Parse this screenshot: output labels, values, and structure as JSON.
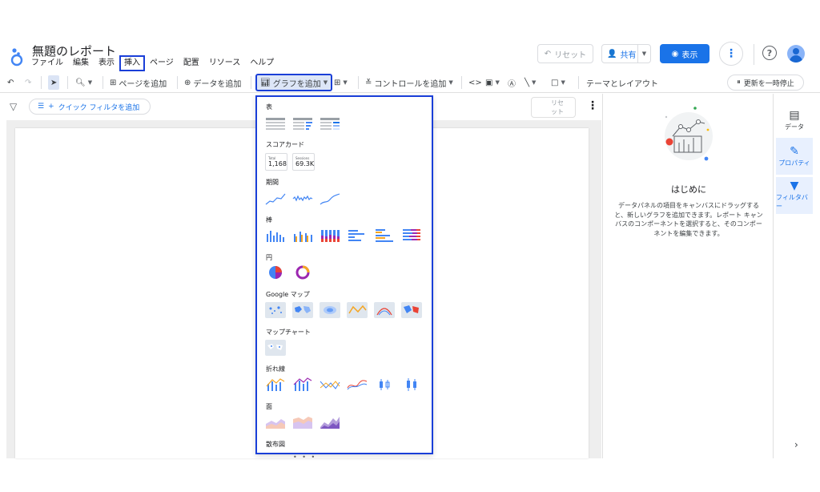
{
  "header": {
    "title": "無題のレポート",
    "menu": [
      "ファイル",
      "編集",
      "表示",
      "挿入",
      "ページ",
      "配置",
      "リソース",
      "ヘルプ"
    ],
    "reset_label": "リセット",
    "share_label": "共有",
    "view_label": "表示",
    "help_glyph": "?"
  },
  "toolbar": {
    "add_page": "ページを追加",
    "add_data": "データを追加",
    "add_chart": "グラフを追加",
    "add_control": "コントロールを追加",
    "theme_layout": "テーマとレイアウト",
    "pause_updates": "更新を一時停止"
  },
  "filterbar": {
    "quick_filter": "クイック フィルタを追加",
    "canvas_reset_line1": "リセ",
    "canvas_reset_line2": "ット"
  },
  "panel": {
    "title": "はじめに",
    "description": "データパネルの項目をキャンバスにドラッグすると、新しいグラフを追加できます。レポート キャンバスのコンポーネントを選択すると、そのコンポーネントを編集できます。"
  },
  "rail": {
    "data": "データ",
    "properties": "プロパティ",
    "filter": "フィルタバー"
  },
  "dropdown": {
    "sections": {
      "table": "表",
      "scorecard": "スコアカード",
      "timeseries": "期間",
      "bar": "棒",
      "pie": "円",
      "google_maps": "Google マップ",
      "map_chart": "マップチャート",
      "line": "折れ線",
      "area": "面",
      "scatter": "散布図"
    },
    "scorecards": [
      {
        "label": "Total",
        "value": "1,168"
      },
      {
        "label": "Sessions",
        "value": "69.3K"
      }
    ]
  },
  "colors": {
    "accent": "#1a73e8",
    "highlight_outline": "#1a3fd8",
    "bar_blue": "#4285f4",
    "bar_orange": "#f5a623",
    "bar_purple": "#9c27b0"
  }
}
